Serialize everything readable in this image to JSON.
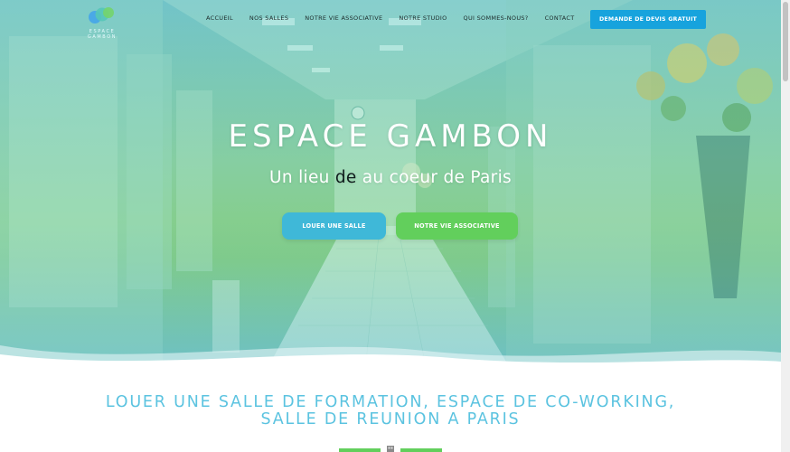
{
  "brand": {
    "logo_text_line1": "ESPACE",
    "logo_text_line2": "GAMBON",
    "logo_icon": "espace-gambon-logo-icon"
  },
  "nav": {
    "items": [
      {
        "label": "ACCUEIL"
      },
      {
        "label": "NOS SALLES"
      },
      {
        "label": "NOTRE VIE ASSOCIATIVE"
      },
      {
        "label": "NOTRE STUDIO"
      },
      {
        "label": "QUI SOMMES-NOUS?"
      },
      {
        "label": "CONTACT"
      }
    ],
    "cta_label": "DEMANDE DE DEVIS GRATUIT"
  },
  "hero": {
    "title": "ESPACE GAMBON",
    "subtitle_part1": "Un lieu",
    "subtitle_highlight": "de",
    "subtitle_part2": "au coeur de Paris",
    "button_rent": "LOUER UNE SALLE",
    "button_assoc": "NOTRE VIE ASSOCIATIVE"
  },
  "section": {
    "title_line1": "LOUER UNE SALLE DE FORMATION, ESPACE DE CO-WORKING,",
    "title_line2": "SALLE DE REUNION A PARIS",
    "divider_icon": "building-icon"
  },
  "colors": {
    "accent_blue": "#17a3dd",
    "button_blue": "#3fb8d8",
    "button_green": "#62cf5c",
    "section_title": "#5bc3e0"
  }
}
